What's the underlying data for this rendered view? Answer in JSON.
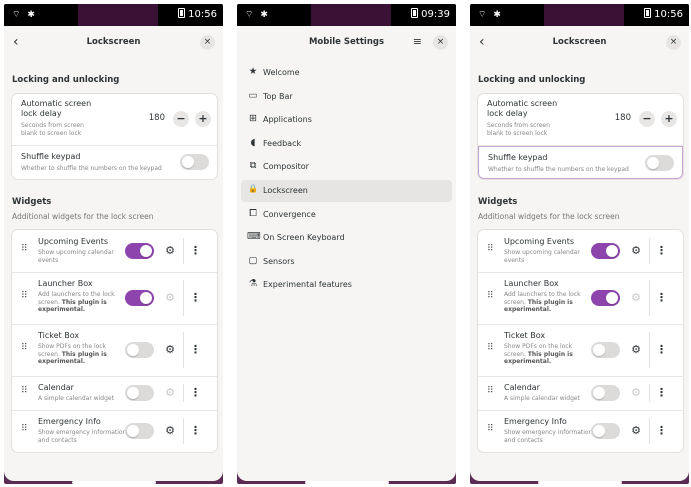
{
  "statusbar": [
    {
      "time": "10:56"
    },
    {
      "time": "09:39"
    },
    {
      "time": "10:56"
    }
  ],
  "screen1": {
    "title": "Lockscreen",
    "locking_section": "Locking and unlocking",
    "delay_title": "Automatic screen lock delay",
    "delay_sub": "Seconds from screen blank to screen lock",
    "delay_value": "180",
    "minus": "−",
    "plus": "+",
    "shuffle_title": "Shuffle keypad",
    "shuffle_sub": "Whether to shuffle the numbers on the keypad",
    "shuffle_on": false,
    "widgets_section": "Widgets",
    "widgets_sub": "Additional widgets for the lock screen",
    "widgets": [
      {
        "title": "Upcoming Events",
        "sub": "Show upcoming calendar events",
        "sub_bold": "",
        "on": true,
        "gear_active": true
      },
      {
        "title": "Launcher Box",
        "sub": "Add launchers to the lock screen. ",
        "sub_bold": "This plugin is experimental.",
        "on": true,
        "gear_active": false
      },
      {
        "title": "Ticket Box",
        "sub": "Show PDFs on the lock screen. ",
        "sub_bold": "This plugin is experimental.",
        "on": false,
        "gear_active": true
      },
      {
        "title": "Calendar",
        "sub": "A simple calendar widget",
        "sub_bold": "",
        "on": false,
        "gear_active": false
      },
      {
        "title": "Emergency Info",
        "sub": "Show emergency information and contacts",
        "sub_bold": "",
        "on": false,
        "gear_active": true
      }
    ]
  },
  "screen2": {
    "title": "Mobile Settings",
    "nav": [
      {
        "label": "Welcome",
        "icon": "star-icon",
        "glyph": "★",
        "selected": false
      },
      {
        "label": "Top Bar",
        "icon": "top-bar-icon",
        "glyph": "▭",
        "selected": false
      },
      {
        "label": "Applications",
        "icon": "applications-icon",
        "glyph": "⊞",
        "selected": false
      },
      {
        "label": "Feedback",
        "icon": "feedback-icon",
        "glyph": "◖",
        "selected": false
      },
      {
        "label": "Compositor",
        "icon": "compositor-icon",
        "glyph": "⧉",
        "selected": false
      },
      {
        "label": "Lockscreen",
        "icon": "lock-icon",
        "glyph": "🔒",
        "selected": true
      },
      {
        "label": "Convergence",
        "icon": "convergence-icon",
        "glyph": "⧠",
        "selected": false
      },
      {
        "label": "On Screen Keyboard",
        "icon": "keyboard-icon",
        "glyph": "⌨",
        "selected": false
      },
      {
        "label": "Sensors",
        "icon": "sensors-icon",
        "glyph": "▢",
        "selected": false
      },
      {
        "label": "Experimental features",
        "icon": "flask-icon",
        "glyph": "⚗",
        "selected": false
      }
    ]
  },
  "icons": {
    "back": "‹",
    "close": "×",
    "menu": "≡",
    "gear": "⚙",
    "kebab": "⋮",
    "drag": "⠿"
  },
  "colors": {
    "accent": "#8e44ad",
    "wallpaper": "#5c2b54",
    "focus": "#c9a3d6"
  }
}
